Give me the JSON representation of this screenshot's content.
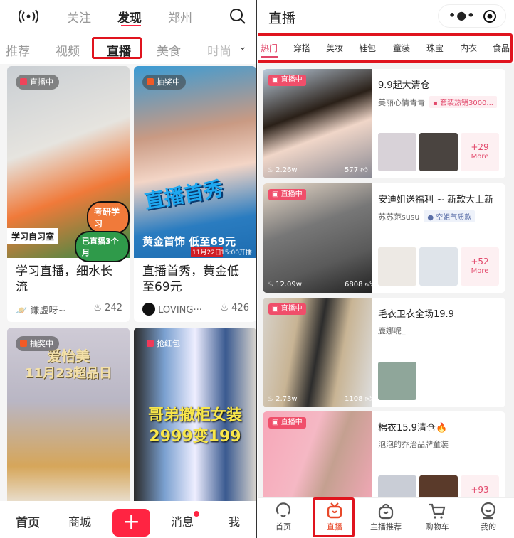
{
  "left": {
    "top_tabs": [
      {
        "label": "关注"
      },
      {
        "label": "发现",
        "active": true
      },
      {
        "label": "郑州"
      }
    ],
    "icons": {
      "live": "broadcast-icon",
      "search": "search-icon"
    },
    "sub_tabs": [
      {
        "label": "推荐"
      },
      {
        "label": "视频"
      },
      {
        "label": "直播",
        "active": true
      },
      {
        "label": "美食"
      },
      {
        "label": "时尚"
      }
    ],
    "cards": [
      {
        "badge": "直播中",
        "badge_color": "#f0445a",
        "overlay": [
          "考研学习",
          "已直播3个月",
          "学习自习室"
        ],
        "title": "学习直播，细水长流",
        "author": "谦虚呀~",
        "heat": "242"
      },
      {
        "badge": "抽奖中",
        "badge_color": "#f25a26",
        "overlay": [
          "直播首秀",
          "黄金首饰 低至69元",
          "11月22日",
          "15:00开播"
        ],
        "title": "直播首秀，黄金低至69元",
        "author": "LOVING···",
        "heat": "426"
      },
      {
        "badge": "抽奖中",
        "badge_color": "#f25a26",
        "overlay": [
          "爱怡美",
          "11月23超品日"
        ]
      },
      {
        "badge": "抢红包",
        "badge_color": "#f03a5a",
        "overlay": [
          "哥弟撤柜女装",
          "2999变199"
        ]
      }
    ],
    "bottom_nav": [
      {
        "label": "首页",
        "active": true
      },
      {
        "label": "商城"
      },
      {
        "label": "+"
      },
      {
        "label": "消息",
        "dot": true
      },
      {
        "label": "我"
      }
    ],
    "accent": "#ff2442"
  },
  "right": {
    "title": "直播",
    "icons": {
      "more": "more-dots-icon",
      "close": "target-icon"
    },
    "categories": [
      {
        "label": "热门",
        "active": true
      },
      {
        "label": "穿搭"
      },
      {
        "label": "美妆"
      },
      {
        "label": "鞋包"
      },
      {
        "label": "童装"
      },
      {
        "label": "珠宝"
      },
      {
        "label": "内衣"
      },
      {
        "label": "食品"
      }
    ],
    "rooms": [
      {
        "badge": "直播中",
        "title": "9.9起大清仓",
        "anchor": "美丽心情青青",
        "tag": "套装热销3000...",
        "tag_color": "pink",
        "views": "2.26w",
        "likes": "577",
        "more_count": "+29",
        "more_label": "More",
        "thumbs": 2
      },
      {
        "badge": "直播中",
        "title": "安迪姐送福利 ~ 新款大上新",
        "anchor": "苏苏范susu",
        "tag": "空姐气质款",
        "tag_color": "blue",
        "views": "12.09w",
        "likes": "6808",
        "more_count": "+52",
        "more_label": "More",
        "thumbs": 2
      },
      {
        "badge": "直播中",
        "title": "毛衣卫衣全场19.9",
        "anchor": "鹿娜呢_",
        "views": "2.73w",
        "likes": "1108",
        "thumbs": 1
      },
      {
        "badge": "直播中",
        "title": "棉衣15.9清仓🔥",
        "anchor": "泡泡的乔治品牌童装",
        "more_count": "+93",
        "thumbs": 2
      }
    ],
    "bottom_nav": [
      {
        "label": "首页",
        "icon": "home-icon"
      },
      {
        "label": "直播",
        "icon": "tv-icon",
        "active": true
      },
      {
        "label": "主播推荐",
        "icon": "bag-icon"
      },
      {
        "label": "购物车",
        "icon": "cart-icon"
      },
      {
        "label": "我的",
        "icon": "profile-icon"
      }
    ],
    "accent": "#e8492a"
  }
}
